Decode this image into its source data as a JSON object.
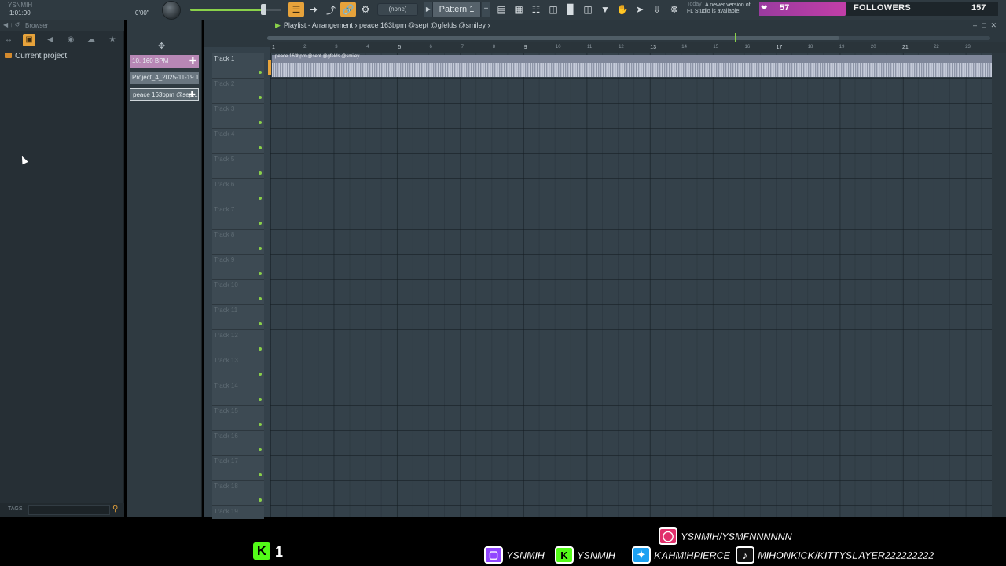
{
  "toolbar": {
    "window_title": "YSNMIH",
    "time_display": "1:01:00",
    "seconds_display": "0'00\"",
    "pattern_none": "(none)",
    "pattern_name": "Pattern 1",
    "news_today": "Today",
    "news_line1": "A newer version of",
    "news_line2": "FL Studio is available!"
  },
  "followers": {
    "current": "57",
    "label": "FOLLOWERS",
    "goal": "157",
    "progress_fraction": 0.363
  },
  "browser": {
    "header": "Browser",
    "items": [
      {
        "label": "Current project"
      }
    ],
    "tags_label": "TAGS"
  },
  "picker": {
    "items": [
      {
        "label": "10. 160 BPM",
        "kind": "automation"
      },
      {
        "label": "Project_4_2025-11-19 1...",
        "kind": "pattern"
      },
      {
        "label": "peace 163bpm @sep...",
        "kind": "audio"
      }
    ]
  },
  "playlist": {
    "title": "Playlist - Arrangement",
    "crumb": "peace 163bpm @sept @gfelds @smiley",
    "clip_label": "peace 163bpm @sept @gfelds @smiley",
    "ruler": [
      "1",
      "2",
      "3",
      "4",
      "5",
      "6",
      "7",
      "8",
      "9",
      "10",
      "11",
      "12",
      "13",
      "14",
      "15",
      "16",
      "17",
      "18",
      "19",
      "20",
      "21",
      "22",
      "23"
    ],
    "tracks": [
      "Track 1",
      "Track 2",
      "Track 3",
      "Track 4",
      "Track 5",
      "Track 6",
      "Track 7",
      "Track 8",
      "Track 9",
      "Track 10",
      "Track 11",
      "Track 12",
      "Track 13",
      "Track 14",
      "Track 15",
      "Track 16",
      "Track 17",
      "Track 18",
      "Track 19"
    ]
  },
  "overlay": {
    "kick_count": "1",
    "instagram": "YSNMIH/YSMFNNNNNN",
    "twitch": "YSNMIH",
    "kick": "YSNMIH",
    "twitter": "KAHMIHPIERCE",
    "tiktok": "MIHONKICK/KITTYSLAYER222222222"
  },
  "colors": {
    "accent_orange": "#e7a33b",
    "accent_green": "#8ad14a",
    "followers_purple": "#c23ea8",
    "kick_green": "#53fc18",
    "twitch_purple": "#9146ff",
    "instagram_pink": "#e1306c",
    "twitter_blue": "#1da1f2"
  }
}
